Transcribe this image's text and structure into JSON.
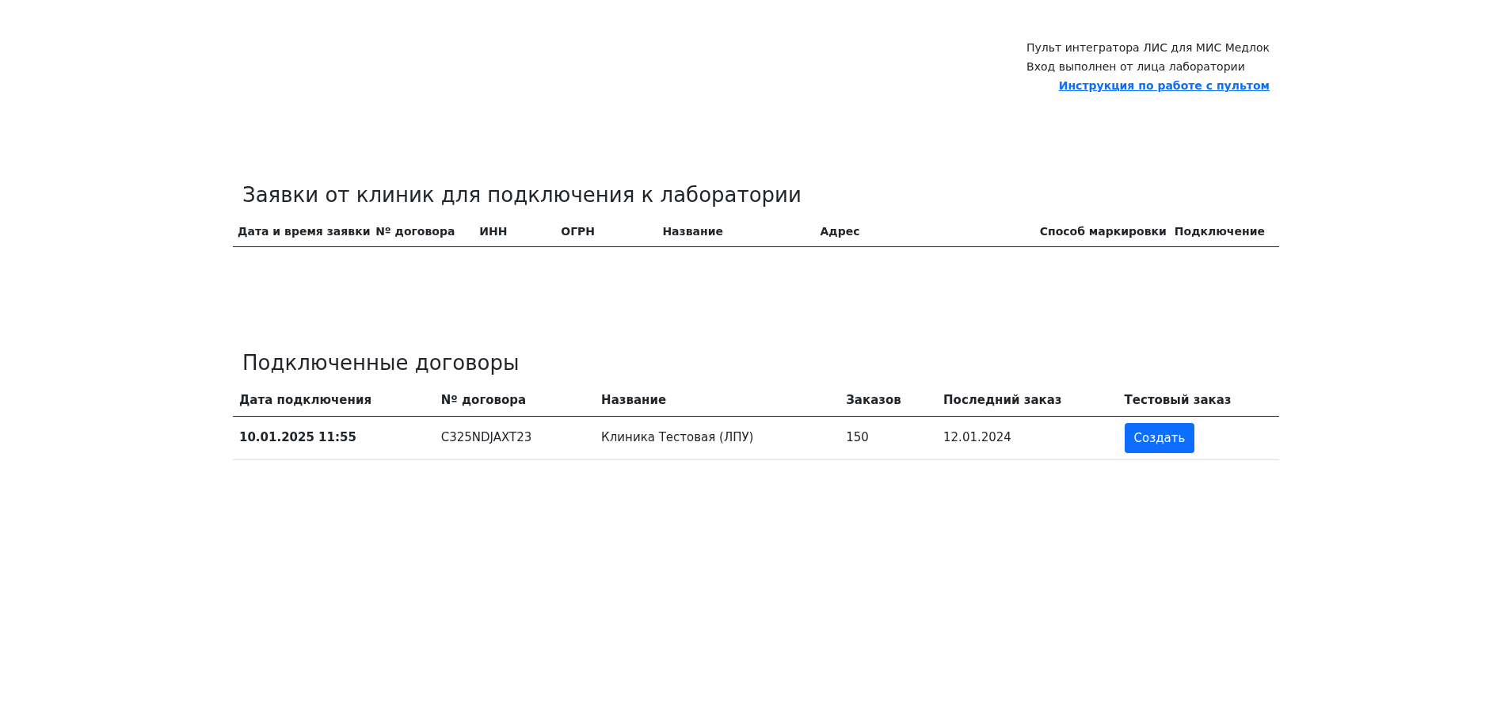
{
  "header": {
    "lines": [
      "Пульт интегратора ЛИС для МИС Медлок",
      "Вход выполнен от лица лаборатории"
    ],
    "link": "Инструкция по работе с пультом"
  },
  "requests": {
    "title": "Заявки от клиник для подключения к лаборатории",
    "columns": [
      "Дата и время заявки",
      "Nº договора",
      "ИНН",
      "ОГРН",
      "Название",
      "Адрес",
      "Способ маркировки",
      "Подключение"
    ]
  },
  "contracts": {
    "title": "Подключенные договоры",
    "columns": [
      "Дата подключения",
      "Nº договора",
      "Название",
      "Заказов",
      "Последний заказ",
      "Тестовый заказ"
    ],
    "rows": [
      {
        "cells": [
          "10.01.2025 11:55",
          "C325NDJAXT23",
          "Клиника Тестовая (ЛПУ)",
          "150",
          "12.01.2024"
        ],
        "button": "Создать"
      }
    ]
  }
}
